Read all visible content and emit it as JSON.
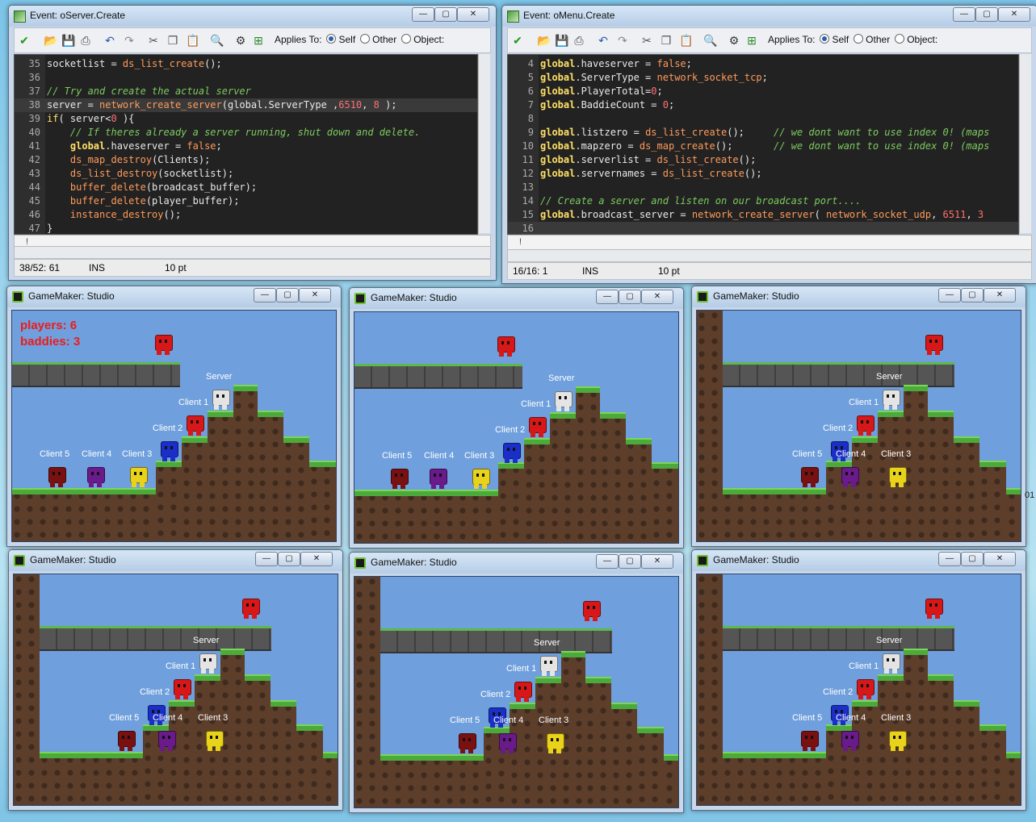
{
  "editors": [
    {
      "title": "Event: oServer.Create",
      "toolbar": {
        "applies_to": "Applies To:",
        "self": "Self",
        "other": "Other",
        "object": "Object:"
      },
      "lines": [
        {
          "n": "35",
          "parts": [
            [
              "tx",
              "socketlist = "
            ],
            [
              "fn",
              "ds_list_create"
            ],
            [
              "tx",
              "();"
            ]
          ]
        },
        {
          "n": "36",
          "parts": []
        },
        {
          "n": "37",
          "parts": [
            [
              "cm",
              "// Try and create the actual server"
            ]
          ]
        },
        {
          "n": "38",
          "parts": [
            [
              "tx",
              "server = "
            ],
            [
              "fn",
              "network_create_server"
            ],
            [
              "tx",
              "(global.ServerType ,"
            ],
            [
              "num",
              "6510"
            ],
            [
              "tx",
              ", "
            ],
            [
              "num",
              "8"
            ],
            [
              "tx",
              " );"
            ]
          ],
          "highlight": true
        },
        {
          "n": "39",
          "parts": [
            [
              "kw",
              "if"
            ],
            [
              "tx",
              "( server<"
            ],
            [
              "num",
              "0"
            ],
            [
              "tx",
              " ){"
            ]
          ]
        },
        {
          "n": "40",
          "parts": [
            [
              "cm",
              "    // If theres already a server running, shut down and delete."
            ]
          ]
        },
        {
          "n": "41",
          "parts": [
            [
              "gl",
              "    global"
            ],
            [
              "tx",
              ".haveserver = "
            ],
            [
              "fn",
              "false"
            ],
            [
              "tx",
              ";"
            ]
          ]
        },
        {
          "n": "42",
          "parts": [
            [
              "tx",
              "    "
            ],
            [
              "fn",
              "ds_map_destroy"
            ],
            [
              "tx",
              "(Clients);"
            ]
          ]
        },
        {
          "n": "43",
          "parts": [
            [
              "tx",
              "    "
            ],
            [
              "fn",
              "ds_list_destroy"
            ],
            [
              "tx",
              "(socketlist);"
            ]
          ]
        },
        {
          "n": "44",
          "parts": [
            [
              "tx",
              "    "
            ],
            [
              "fn",
              "buffer_delete"
            ],
            [
              "tx",
              "(broadcast_buffer);"
            ]
          ]
        },
        {
          "n": "45",
          "parts": [
            [
              "tx",
              "    "
            ],
            [
              "fn",
              "buffer_delete"
            ],
            [
              "tx",
              "(player_buffer);"
            ]
          ]
        },
        {
          "n": "46",
          "parts": [
            [
              "tx",
              "    "
            ],
            [
              "fn",
              "instance_destroy"
            ],
            [
              "tx",
              "();"
            ]
          ]
        },
        {
          "n": "47",
          "parts": [
            [
              "tx",
              "}"
            ]
          ]
        }
      ],
      "status": {
        "pos": "38/52:  61",
        "mode": "INS",
        "size": "10 pt"
      },
      "marker": "!"
    },
    {
      "title": "Event: oMenu.Create",
      "toolbar": {
        "applies_to": "Applies To:",
        "self": "Self",
        "other": "Other",
        "object": "Object:"
      },
      "lines": [
        {
          "n": "4",
          "parts": [
            [
              "gl",
              "global"
            ],
            [
              "tx",
              ".haveserver = "
            ],
            [
              "fn",
              "false"
            ],
            [
              "tx",
              ";"
            ]
          ]
        },
        {
          "n": "5",
          "parts": [
            [
              "gl",
              "global"
            ],
            [
              "tx",
              ".ServerType = "
            ],
            [
              "fn",
              "network_socket_tcp"
            ],
            [
              "tx",
              ";"
            ]
          ]
        },
        {
          "n": "6",
          "parts": [
            [
              "gl",
              "global"
            ],
            [
              "tx",
              ".PlayerTotal="
            ],
            [
              "num",
              "0"
            ],
            [
              "tx",
              ";"
            ]
          ]
        },
        {
          "n": "7",
          "parts": [
            [
              "gl",
              "global"
            ],
            [
              "tx",
              ".BaddieCount = "
            ],
            [
              "num",
              "0"
            ],
            [
              "tx",
              ";"
            ]
          ]
        },
        {
          "n": "8",
          "parts": []
        },
        {
          "n": "9",
          "parts": [
            [
              "gl",
              "global"
            ],
            [
              "tx",
              ".listzero = "
            ],
            [
              "fn",
              "ds_list_create"
            ],
            [
              "tx",
              "();     "
            ],
            [
              "cm",
              "// we dont want to use index 0! (maps"
            ]
          ]
        },
        {
          "n": "10",
          "parts": [
            [
              "gl",
              "global"
            ],
            [
              "tx",
              ".mapzero = "
            ],
            [
              "fn",
              "ds_map_create"
            ],
            [
              "tx",
              "();       "
            ],
            [
              "cm",
              "// we dont want to use index 0! (maps"
            ]
          ]
        },
        {
          "n": "11",
          "parts": [
            [
              "gl",
              "global"
            ],
            [
              "tx",
              ".serverlist = "
            ],
            [
              "fn",
              "ds_list_create"
            ],
            [
              "tx",
              "();"
            ]
          ]
        },
        {
          "n": "12",
          "parts": [
            [
              "gl",
              "global"
            ],
            [
              "tx",
              ".servernames = "
            ],
            [
              "fn",
              "ds_list_create"
            ],
            [
              "tx",
              "();"
            ]
          ]
        },
        {
          "n": "13",
          "parts": []
        },
        {
          "n": "14",
          "parts": [
            [
              "cm",
              "// Create a server and listen on our broadcast port...."
            ]
          ]
        },
        {
          "n": "15",
          "parts": [
            [
              "gl",
              "global"
            ],
            [
              "tx",
              ".broadcast_server = "
            ],
            [
              "fn",
              "network_create_server"
            ],
            [
              "tx",
              "( "
            ],
            [
              "fn",
              "network_socket_udp"
            ],
            [
              "tx",
              ", "
            ],
            [
              "num",
              "6511"
            ],
            [
              "tx",
              ", "
            ],
            [
              "num",
              "3"
            ]
          ]
        },
        {
          "n": "16",
          "parts": [],
          "highlight": true
        }
      ],
      "status": {
        "pos": "16/16:  1",
        "mode": "INS",
        "size": "10 pt"
      },
      "marker": "!"
    }
  ],
  "game": {
    "window_title": "GameMaker: Studio",
    "hud": {
      "players": "players: 6",
      "baddies": "baddies: 3"
    },
    "labels": {
      "server": "Server",
      "c1": "Client 1",
      "c2": "Client 2",
      "c3": "Client 3",
      "c4": "Client 4",
      "c5": "Client 5"
    },
    "colors": {
      "red": "#d81818",
      "white": "#e4e4e4",
      "blue": "#1a2fc8",
      "yellow": "#e8d21a",
      "purple": "#6a1a8a",
      "darkred": "#7a1010"
    }
  },
  "side_text": "01"
}
